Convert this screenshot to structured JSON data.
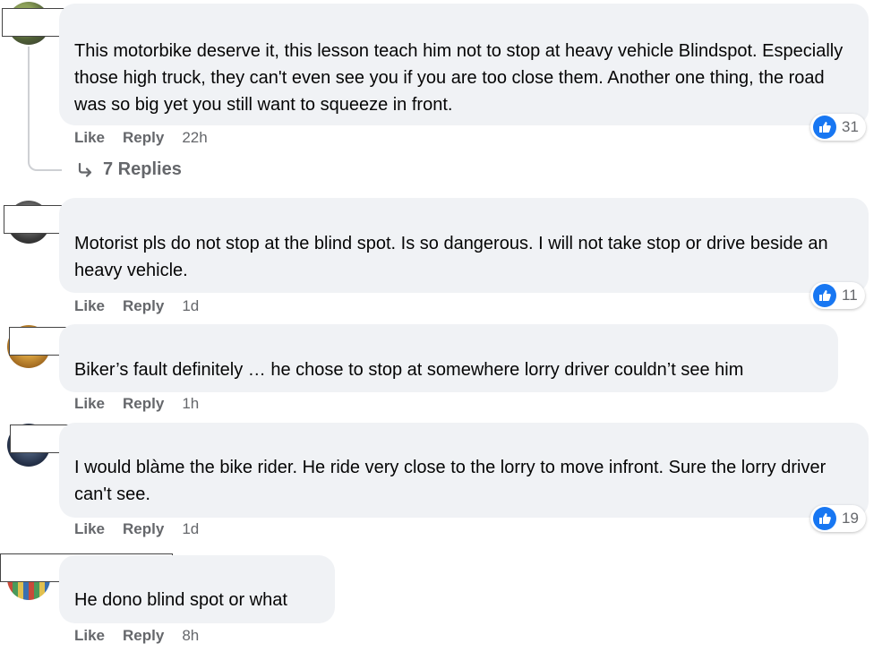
{
  "actions": {
    "like_label": "Like",
    "reply_label": "Reply"
  },
  "comments": [
    {
      "text": "This motorbike deserve it, this lesson teach him not to stop at heavy vehicle Blindspot. Especially those high truck, they can't even see you if you are too close them. Another one thing, the road was so big yet you still want to squeeze in front.",
      "time": "22h",
      "reactions": "31",
      "replies_label": "7 Replies"
    },
    {
      "text": "Motorist pls do not stop at the blind spot. Is so dangerous. I will not take stop or drive beside an heavy vehicle.",
      "time": "1d",
      "reactions": "11"
    },
    {
      "text": "Biker’s fault definitely … he chose to stop at somewhere lorry driver couldn’t see him",
      "time": "1h"
    },
    {
      "text": "I would blàme the bike rider. He ride very close to the lorry to move infront. Sure the lorry driver can't see.",
      "time": "1d",
      "reactions": "19"
    },
    {
      "text": "He dono blind spot or what",
      "time": "8h"
    }
  ],
  "colors": {
    "bubble": "#f0f2f5",
    "meta": "#65676b",
    "like_blue": "#1877f2"
  },
  "icons": {
    "reaction": "thumbs-up-icon",
    "reply_arrow": "reply-arrow-icon"
  }
}
